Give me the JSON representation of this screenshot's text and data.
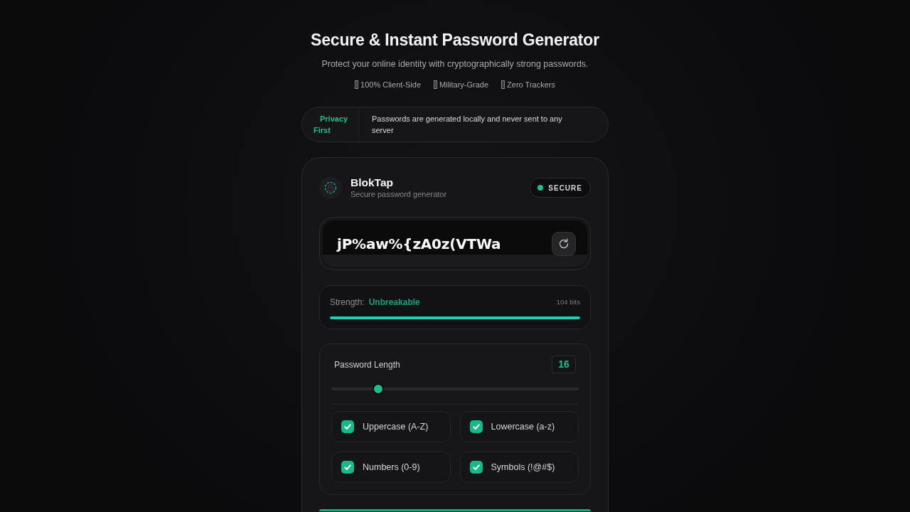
{
  "header": {
    "title": "Secure & Instant Password Generator",
    "subtitle": "Protect your online identity with cryptographically strong passwords.",
    "features": [
      "100% Client-Side",
      "Military-Grade",
      "Zero Trackers"
    ]
  },
  "privacy_banner": {
    "label": "Privacy First",
    "message": "Passwords are generated locally and never sent to any server"
  },
  "generator": {
    "brand": {
      "name": "BlokTap",
      "tagline": "Secure password generator"
    },
    "status": "SECURE",
    "password": "jP%aw%{zA0z(VTWa",
    "strength": {
      "label": "Strength:",
      "rating": "Unbreakable",
      "bits": "104 bits",
      "level": 1
    },
    "length": {
      "label": "Password Length",
      "value": "16",
      "level": 0.19
    },
    "options": [
      {
        "label": "Uppercase (A-Z)",
        "checked": true
      },
      {
        "label": "Lowercase (a-z)",
        "checked": true
      },
      {
        "label": "Numbers (0-9)",
        "checked": true
      },
      {
        "label": "Symbols (!@#$)",
        "checked": true
      }
    ]
  }
}
